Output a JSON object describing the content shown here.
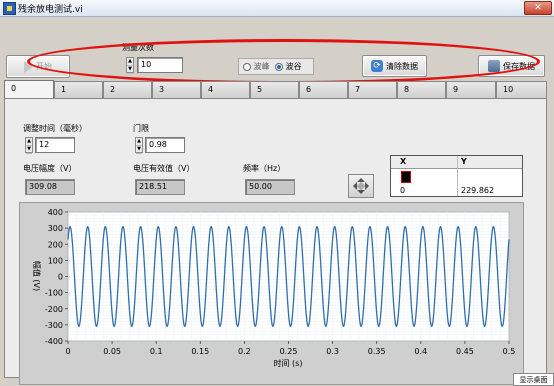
{
  "window": {
    "title": "残余放电测试.vi",
    "close_glyph": "✕"
  },
  "toolbar": {
    "start_label": "开始",
    "count_label": "测量次数",
    "count_value": "10",
    "radio_options": [
      {
        "label": "波峰",
        "selected": false
      },
      {
        "label": "波谷",
        "selected": true
      }
    ],
    "clear_label": "清除数据",
    "save_label": "保存数据"
  },
  "tabs": [
    "0",
    "1",
    "2",
    "3",
    "4",
    "5",
    "6",
    "7",
    "8",
    "9",
    "10"
  ],
  "active_tab": "0",
  "controls": {
    "adjust_time_label": "调整时间（毫秒）",
    "adjust_time_value": "12",
    "threshold_label": "门限",
    "threshold_value": "0.98",
    "amplitude_label": "电压幅度（V）",
    "amplitude_value": "309.08",
    "rms_label": "电压有效值（V）",
    "rms_value": "218.51",
    "freq_label": "频率（Hz）",
    "freq_value": "50.00"
  },
  "cursor_table": {
    "headers": [
      "X",
      "Y"
    ],
    "row": {
      "x": "0",
      "y": "229.862"
    }
  },
  "tray_label": "显示桌面",
  "chart_data": {
    "type": "line",
    "xlabel": "时间 (s)",
    "ylabel": "幅值 (V)",
    "xlim": [
      0,
      0.5
    ],
    "ylim": [
      -400,
      400
    ],
    "x_ticks": [
      "0",
      "0.05",
      "0.1",
      "0.15",
      "0.2",
      "0.25",
      "0.3",
      "0.35",
      "0.4",
      "0.45",
      "0.5"
    ],
    "y_ticks": [
      "400",
      "300",
      "200",
      "100",
      "0",
      "-100",
      "-200",
      "-300",
      "-400"
    ],
    "grid": true,
    "series": [
      {
        "amplitude": 309.08,
        "frequency_hz": 50,
        "phase_rad": 0.84,
        "color": "#2f6fae"
      }
    ]
  },
  "colors": {
    "accent": "#2f6fae",
    "highlight_circle": "#e21111"
  }
}
